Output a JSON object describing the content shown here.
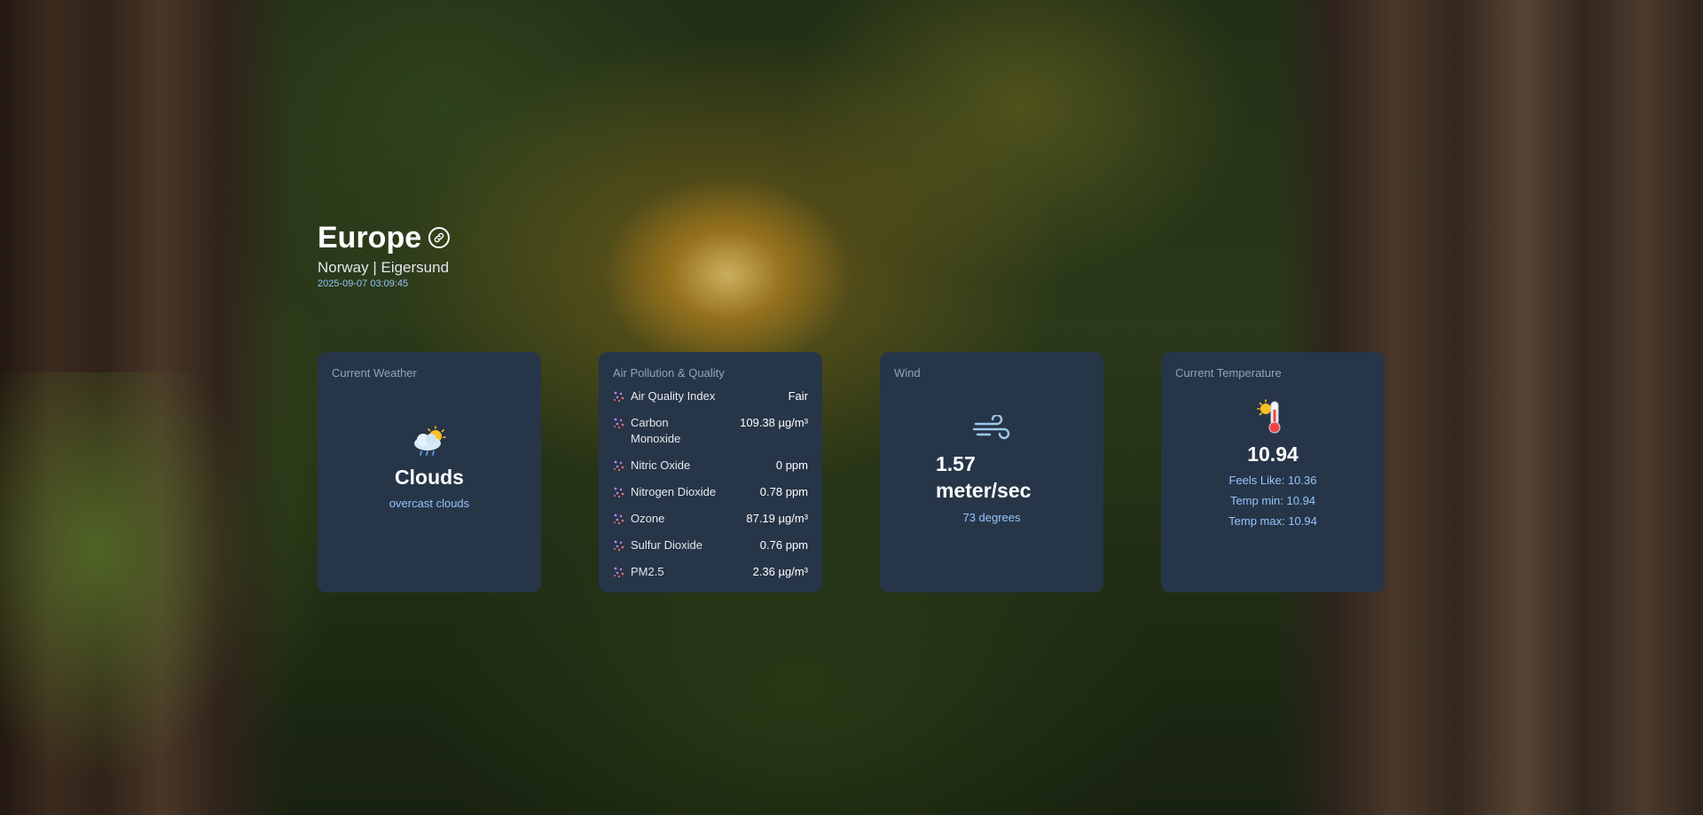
{
  "header": {
    "title": "Europe",
    "subtitle": "Norway | Eigersund",
    "timestamp": "2025-09-07 03:09:45"
  },
  "current_weather": {
    "title": "Current Weather",
    "icon": "cloud-rain-sun-icon",
    "main": "Clouds",
    "description": "overcast clouds"
  },
  "air_quality": {
    "title": "Air Pollution & Quality",
    "icon": "particles-icon",
    "items": [
      {
        "label": "Air Quality Index",
        "value": "Fair"
      },
      {
        "label": "Carbon Monoxide",
        "value": "109.38 µg/m³"
      },
      {
        "label": "Nitric Oxide",
        "value": "0 ppm"
      },
      {
        "label": "Nitrogen Dioxide",
        "value": "0.78 ppm"
      },
      {
        "label": "Ozone",
        "value": "87.19 µg/m³"
      },
      {
        "label": "Sulfur Dioxide",
        "value": "0.76 ppm"
      },
      {
        "label": "PM2.5",
        "value": "2.36 µg/m³"
      }
    ]
  },
  "wind": {
    "title": "Wind",
    "icon": "wind-icon",
    "speed": "1.57 meter/sec",
    "direction": "73 degrees"
  },
  "temperature": {
    "title": "Current Temperature",
    "icon": "thermometer-sun-icon",
    "value": "10.94",
    "feels_like": "Feels Like: 10.36",
    "temp_min": "Temp min: 10.94",
    "temp_max": "Temp max: 10.94"
  },
  "colors": {
    "card_bg": "#273548",
    "card_title": "#94a3b8",
    "accent_text": "#93c5fd"
  }
}
